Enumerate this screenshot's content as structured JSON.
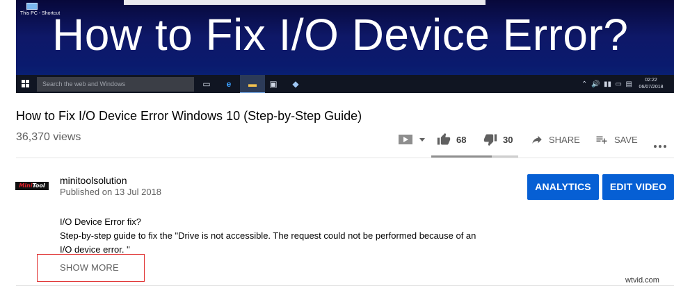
{
  "player": {
    "desktop_icon_label": "This PC - Shortcut",
    "overlay_title": "How to Fix I/O Device Error?",
    "taskbar": {
      "search_placeholder": "Search the web and Windows",
      "clock_time": "02:22",
      "clock_date": "06/07/2018"
    }
  },
  "video": {
    "title": "How to Fix I/O Device Error Windows 10 (Step-by-Step Guide)",
    "views": "36,370 views",
    "likes": "68",
    "dislikes": "30",
    "like_ratio": 0.694,
    "share_label": "SHARE",
    "save_label": "SAVE"
  },
  "channel": {
    "logo_text_a": "Mini",
    "logo_text_b": "Tool",
    "name": "minitoolsolution",
    "published": "Published on 13 Jul 2018"
  },
  "buttons": {
    "analytics": "ANALYTICS",
    "edit_video": "EDIT VIDEO"
  },
  "description": {
    "line1": "I/O Device Error  fix?",
    "line2": "Step-by-step guide to fix the \"Drive is not accessible. The request could not be performed because of an",
    "line3": "I/O device error. \"",
    "show_more": "SHOW MORE"
  },
  "watermark": "wtvid.com",
  "colors": {
    "primary_button": "#065fd4",
    "highlight_box": "#e03131"
  }
}
